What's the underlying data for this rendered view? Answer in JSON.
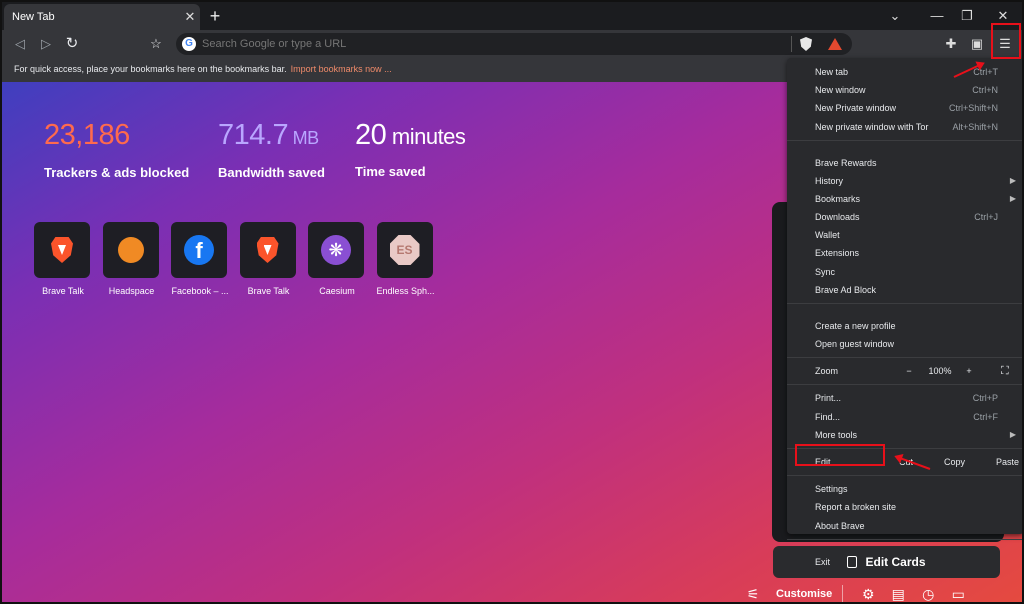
{
  "tab": {
    "title": "New Tab",
    "close": "✕"
  },
  "window_controls": {
    "tab_search": "⌄",
    "minimize": "—",
    "restore": "❐",
    "close": "✕"
  },
  "toolbar": {
    "back": "◁",
    "forward": "▷",
    "reload": "↻",
    "bookmark": "☆",
    "placeholder": "Search Google or type a URL",
    "extensions": "✚",
    "wallet": "▣",
    "menu": "☰"
  },
  "bookmarks_bar": {
    "text": "For quick access, place your bookmarks here on the bookmarks bar.",
    "import_link": "Import bookmarks now ..."
  },
  "stats": [
    {
      "value": "23,186",
      "unit": "",
      "label": "Trackers & ads blocked",
      "color": "#ff6a4d"
    },
    {
      "value": "714.7",
      "unit": " MB",
      "label": "Bandwidth saved",
      "color": "#b9a6ff"
    },
    {
      "value": "20",
      "unit": " minutes",
      "label": "Time saved",
      "color": "#ffffff"
    }
  ],
  "tiles": [
    {
      "label": "Brave Talk",
      "icon": "brave-lion-icon"
    },
    {
      "label": "Headspace",
      "icon": "orange-dot-icon"
    },
    {
      "label": "Facebook – ...",
      "icon": "facebook-icon"
    },
    {
      "label": "Brave Talk",
      "icon": "brave-lion-icon"
    },
    {
      "label": "Caesium",
      "icon": "caesium-icon"
    },
    {
      "label": "Endless Sph...",
      "icon": "endless-sphere-icon"
    }
  ],
  "tile_glyphs": {
    "facebook": "f",
    "caesium": "❋",
    "endless": "ES"
  },
  "menu": {
    "new_tab": {
      "label": "New tab",
      "shortcut": "Ctrl+T"
    },
    "new_window": {
      "label": "New window",
      "shortcut": "Ctrl+N"
    },
    "new_private_window": {
      "label": "New Private window",
      "shortcut": "Ctrl+Shift+N"
    },
    "new_private_tor": {
      "label": "New private window with Tor",
      "shortcut": "Alt+Shift+N"
    },
    "brave_rewards": {
      "label": "Brave Rewards"
    },
    "history": {
      "label": "History"
    },
    "bookmarks": {
      "label": "Bookmarks"
    },
    "downloads": {
      "label": "Downloads",
      "shortcut": "Ctrl+J"
    },
    "wallet": {
      "label": "Wallet"
    },
    "extensions": {
      "label": "Extensions"
    },
    "sync": {
      "label": "Sync"
    },
    "brave_ad_block": {
      "label": "Brave Ad Block"
    },
    "create_profile": {
      "label": "Create a new profile"
    },
    "guest_window": {
      "label": "Open guest window"
    },
    "zoom": {
      "label": "Zoom",
      "minus": "−",
      "value": "100%",
      "plus": "+",
      "fullscreen": "⛶"
    },
    "print": {
      "label": "Print...",
      "shortcut": "Ctrl+P"
    },
    "find": {
      "label": "Find...",
      "shortcut": "Ctrl+F"
    },
    "more_tools": {
      "label": "More tools"
    },
    "edit": {
      "label": "Edit",
      "cut": "Cut",
      "copy": "Copy",
      "paste": "Paste"
    },
    "settings": {
      "label": "Settings"
    },
    "report_broken": {
      "label": "Report a broken site"
    },
    "about": {
      "label": "About Brave"
    },
    "exit": {
      "label": "Exit"
    },
    "submenu_arrow": "▶"
  },
  "edit_cards": {
    "label": "Edit Cards"
  },
  "bottom_bar": {
    "customise": "Customise",
    "sliders": "⚟",
    "gear": "⚙",
    "bookmark": "▤",
    "history": "◷",
    "video": "▭"
  },
  "annotation_color": "#e8101a"
}
